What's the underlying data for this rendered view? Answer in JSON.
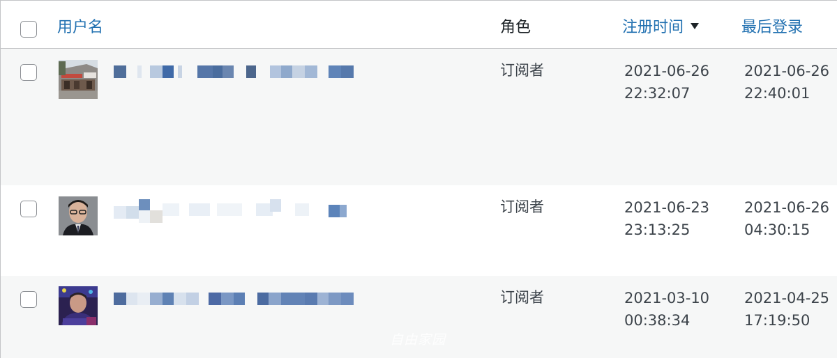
{
  "table": {
    "columns": {
      "username": "用户名",
      "role": "角色",
      "registered": "注册时间",
      "last_login": "最后登录"
    },
    "rows": [
      {
        "role": "订阅者",
        "registered_date": "2021-06-26",
        "registered_time": "22:32:07",
        "last_login_date": "2021-06-26",
        "last_login_time": "22:40:01",
        "avatar": "building-photo"
      },
      {
        "role": "订阅者",
        "registered_date": "2021-06-23",
        "registered_time": "23:13:25",
        "last_login_date": "2021-06-26",
        "last_login_time": "04:30:15",
        "avatar": "man-portrait-photo"
      },
      {
        "role": "订阅者",
        "registered_date": "2021-03-10",
        "registered_time": "00:38:34",
        "last_login_date": "2021-04-25",
        "last_login_time": "17:19:50",
        "avatar": "man-portrait-photo"
      }
    ]
  },
  "watermark": "自由家园",
  "colors": {
    "link": "#2271b1",
    "text": "#3c434a",
    "alt_row": "#f6f7f7",
    "border": "#c3c4c7"
  }
}
